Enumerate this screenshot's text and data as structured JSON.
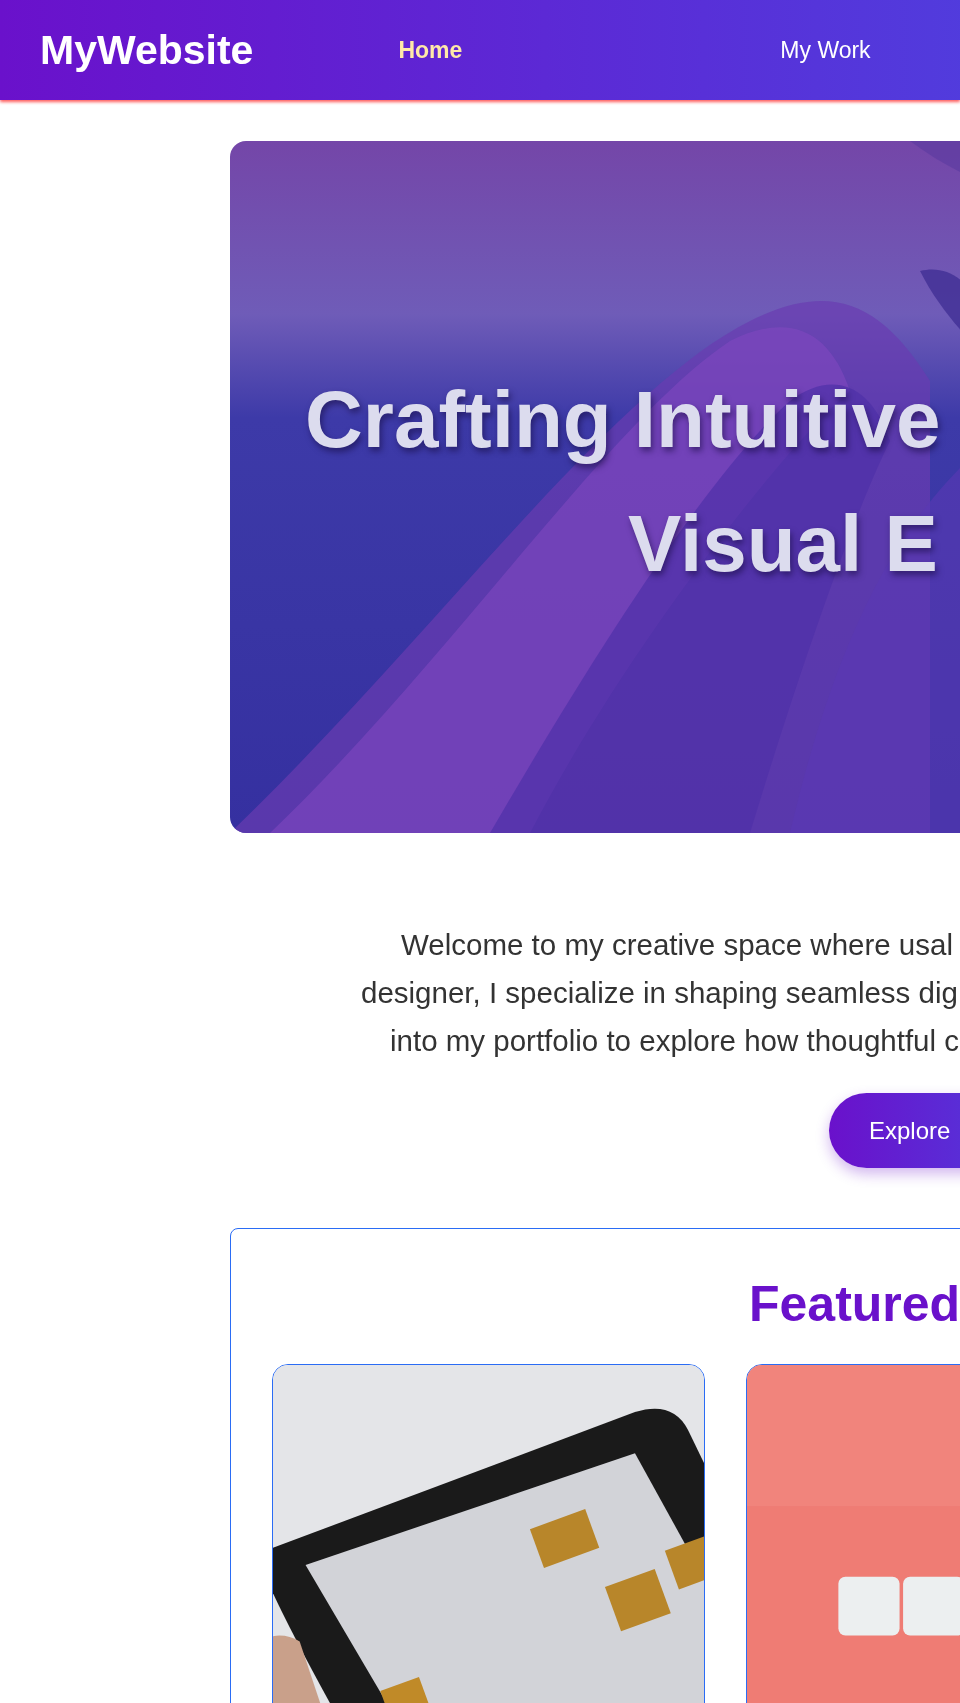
{
  "nav": {
    "logo": "MyWebsite",
    "links": [
      {
        "label": "Home",
        "selected": true
      },
      {
        "label": "My Work",
        "selected": false
      }
    ]
  },
  "hero": {
    "kind": "picture",
    "heading_lines": [
      "Crafting Intuitive",
      "Visual E"
    ]
  },
  "intro": {
    "lines": [
      "Welcome to my creative space where usal",
      "designer, I specialize in shaping seamless dig",
      "into my portfolio to explore how thoughtful c"
    ]
  },
  "cta": {
    "label": "Explore"
  },
  "featured": {
    "title": "Featured"
  }
}
